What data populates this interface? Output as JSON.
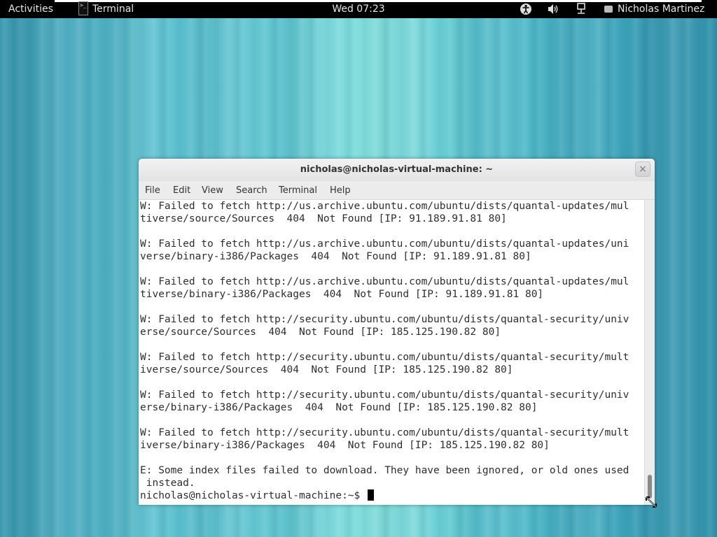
{
  "top_panel": {
    "activities": "Activities",
    "app_name": "Terminal",
    "clock": "Wed 07:23",
    "user_name": "Nicholas Martinez",
    "icons": [
      "accessibility-icon",
      "volume-icon",
      "network-icon",
      "user-status-icon"
    ]
  },
  "window": {
    "title": "nicholas@nicholas-virtual-machine: ~",
    "close_glyph": "×",
    "menu": [
      "File",
      "Edit",
      "View",
      "Search",
      "Terminal",
      "Help"
    ]
  },
  "terminal": {
    "lines": [
      "W: Failed to fetch http://us.archive.ubuntu.com/ubuntu/dists/quantal-updates/mul",
      "tiverse/source/Sources  404  Not Found [IP: 91.189.91.81 80]",
      "",
      "W: Failed to fetch http://us.archive.ubuntu.com/ubuntu/dists/quantal-updates/uni",
      "verse/binary-i386/Packages  404  Not Found [IP: 91.189.91.81 80]",
      "",
      "W: Failed to fetch http://us.archive.ubuntu.com/ubuntu/dists/quantal-updates/mul",
      "tiverse/binary-i386/Packages  404  Not Found [IP: 91.189.91.81 80]",
      "",
      "W: Failed to fetch http://security.ubuntu.com/ubuntu/dists/quantal-security/univ",
      "erse/source/Sources  404  Not Found [IP: 185.125.190.82 80]",
      "",
      "W: Failed to fetch http://security.ubuntu.com/ubuntu/dists/quantal-security/mult",
      "iverse/source/Sources  404  Not Found [IP: 185.125.190.82 80]",
      "",
      "W: Failed to fetch http://security.ubuntu.com/ubuntu/dists/quantal-security/univ",
      "erse/binary-i386/Packages  404  Not Found [IP: 185.125.190.82 80]",
      "",
      "W: Failed to fetch http://security.ubuntu.com/ubuntu/dists/quantal-security/mult",
      "iverse/binary-i386/Packages  404  Not Found [IP: 185.125.190.82 80]",
      "",
      "E: Some index files failed to download. They have been ignored, or old ones used",
      " instead."
    ],
    "prompt": "nicholas@nicholas-virtual-machine:~$ "
  },
  "colors": {
    "panel_bg": "#000000",
    "desktop_accent": "#5bbfce",
    "terminal_bg": "#ffffff",
    "terminal_fg": "#2e2e2e"
  }
}
